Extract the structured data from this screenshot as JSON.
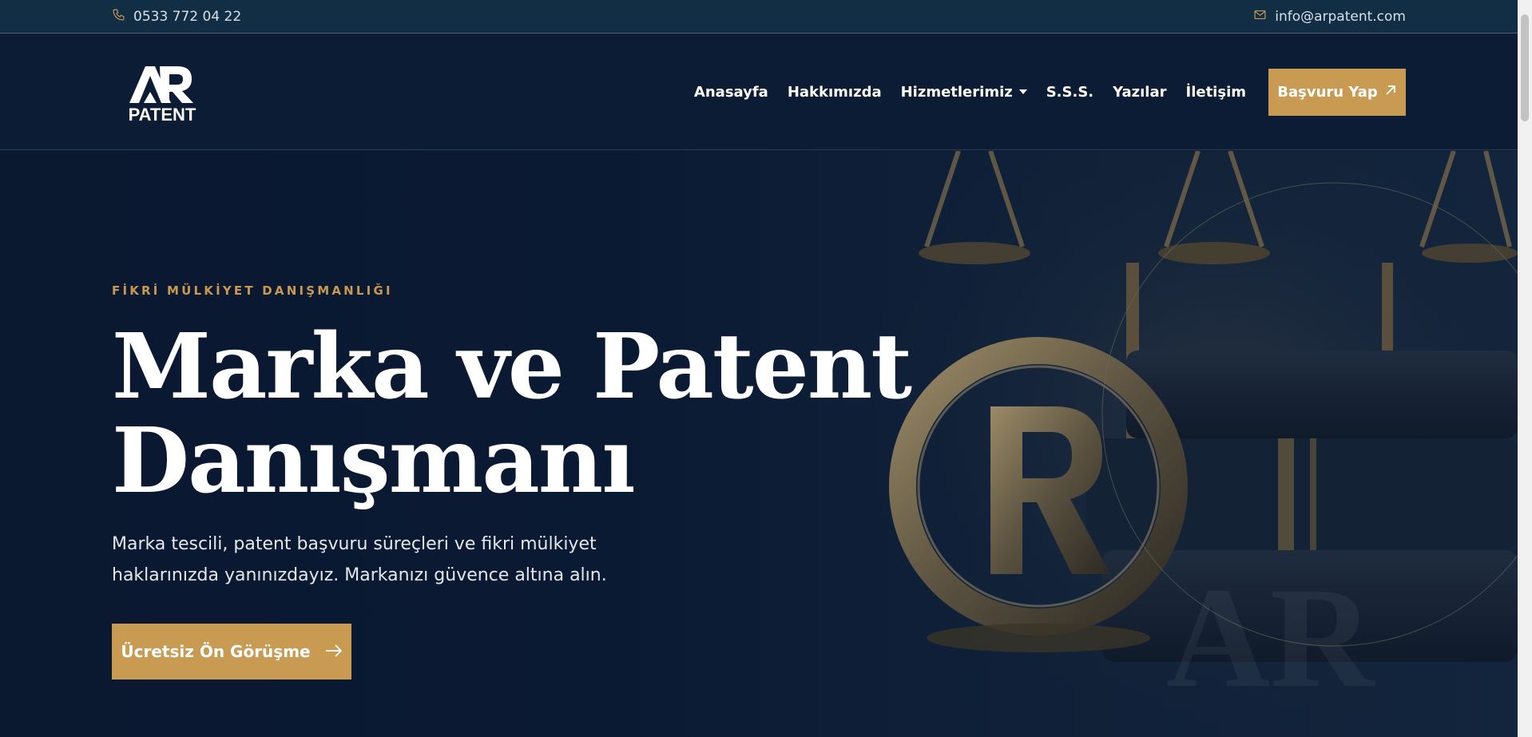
{
  "topbar": {
    "phone": "0533 772 04 22",
    "email": "info@arpatent.com",
    "phone_icon": "phone-icon",
    "email_icon": "mail-icon"
  },
  "header": {
    "logo_text": "PATENT",
    "nav": [
      {
        "label": "Anasayfa"
      },
      {
        "label": "Hakkımızda"
      },
      {
        "label": "Hizmetlerimiz",
        "has_dropdown": true
      },
      {
        "label": "S.S.S."
      },
      {
        "label": "Yazılar"
      },
      {
        "label": "İletişim"
      }
    ],
    "cta_label": "Başvuru Yap"
  },
  "hero": {
    "eyebrow": "FİKRİ MÜLKİYET DANIŞMANLIĞI",
    "title_line1": "Marka ve Patent",
    "title_line2": "Danışmanı",
    "lead": "Marka tescili, patent başvuru süreçleri ve fikri mülkiyet haklarınızda yanınızdayız. Markanızı güvence altına alın.",
    "cta_label": "Ücretsiz Ön Görüşme"
  },
  "colors": {
    "accent": "#c89a52",
    "navy": "#0c1c35",
    "topbar": "#122e45"
  }
}
